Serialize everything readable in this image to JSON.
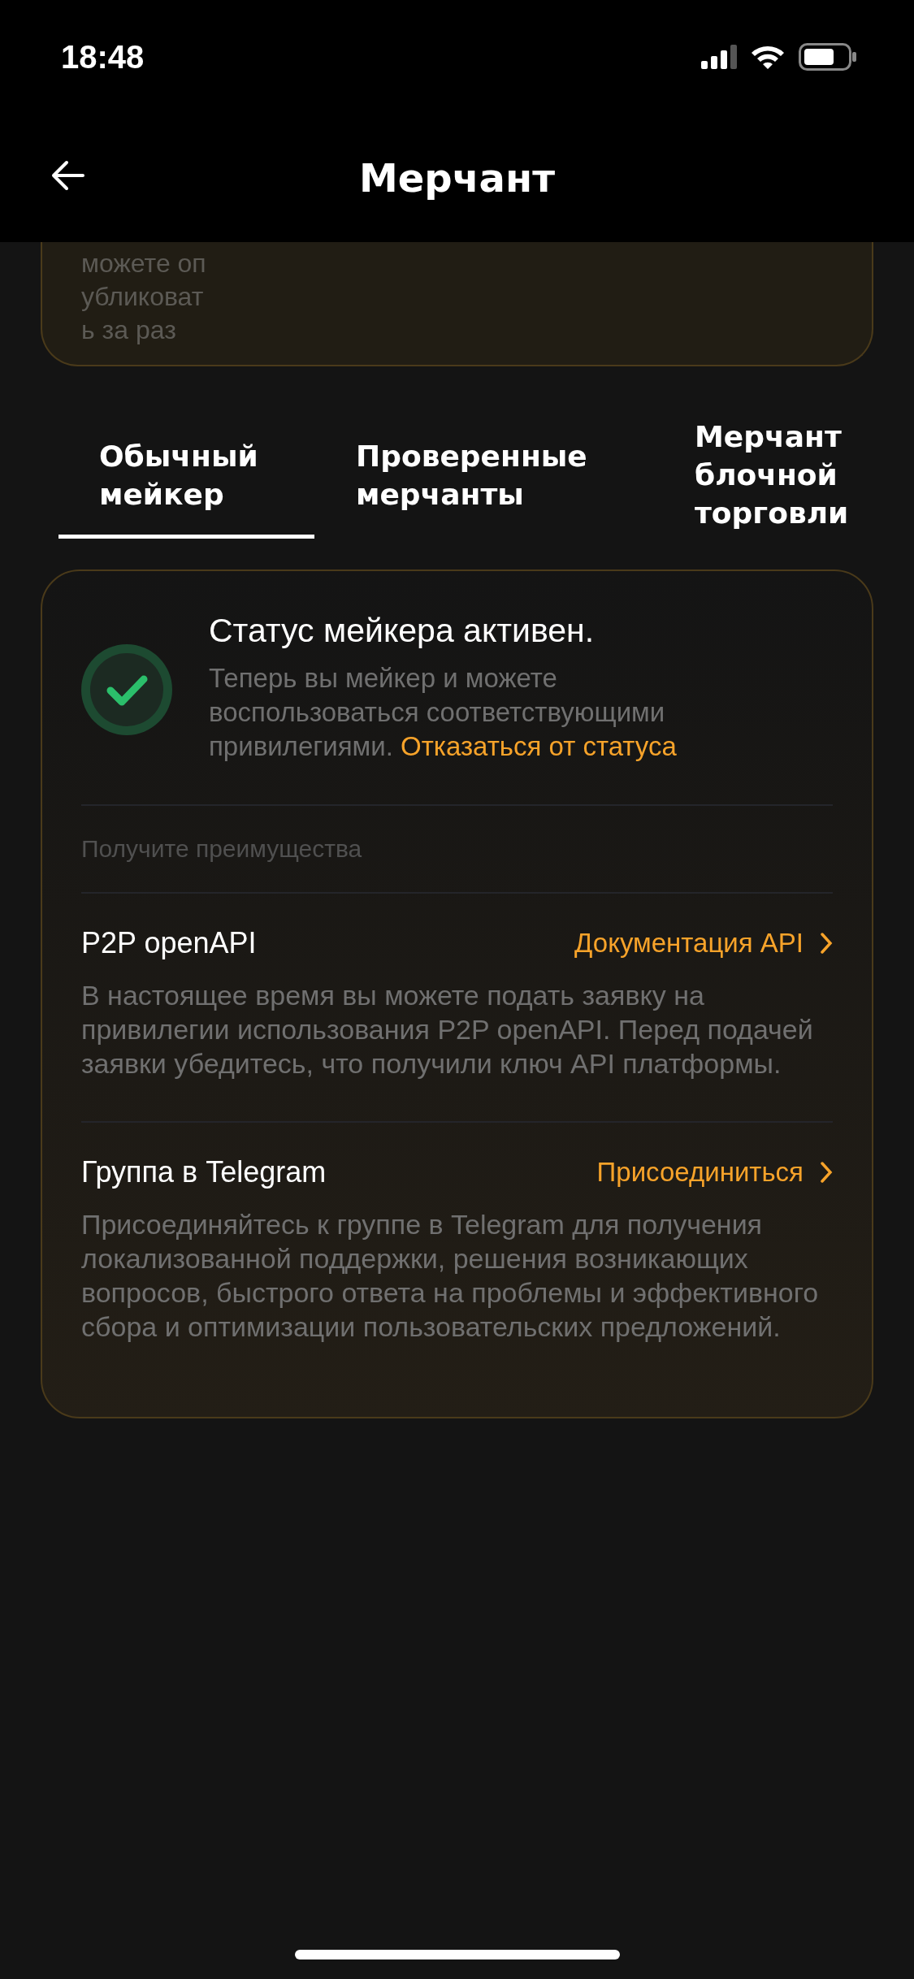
{
  "status_bar": {
    "time": "18:48"
  },
  "header": {
    "title": "Мерчант"
  },
  "previous_card": {
    "text_lines": [
      "можете оп",
      "убликоват",
      "ь за раз"
    ]
  },
  "tabs": [
    {
      "label": "Обычный мейкер",
      "selected": true
    },
    {
      "label": "Проверенные мерчанты",
      "selected": false
    },
    {
      "label": "Мерчант блочной торговли",
      "selected": false
    }
  ],
  "status_card": {
    "title": "Статус мейкера активен.",
    "active": true,
    "description": "Теперь вы мейкер и можете воспользоваться соответствующими привилегиями.",
    "link": "Отказаться от статуса",
    "benefits_heading": "Получите преимущества",
    "benefits": [
      {
        "title": "P2P openAPI",
        "link": "Документация API",
        "description": "В настоящее время вы можете подать заявку на привилегии использования P2P openAPI. Перед подачей заявки убедитесь, что получили ключ API платформы."
      },
      {
        "title": "Группа в Telegram",
        "link": "Присоединиться",
        "description": "Присоединяйтесь к группе в Telegram для получения локализованной поддержки, решения возникающих вопросов, быстрого ответа на проблемы и эффективного сбора и оптимизации пользовательских предложений."
      }
    ]
  }
}
